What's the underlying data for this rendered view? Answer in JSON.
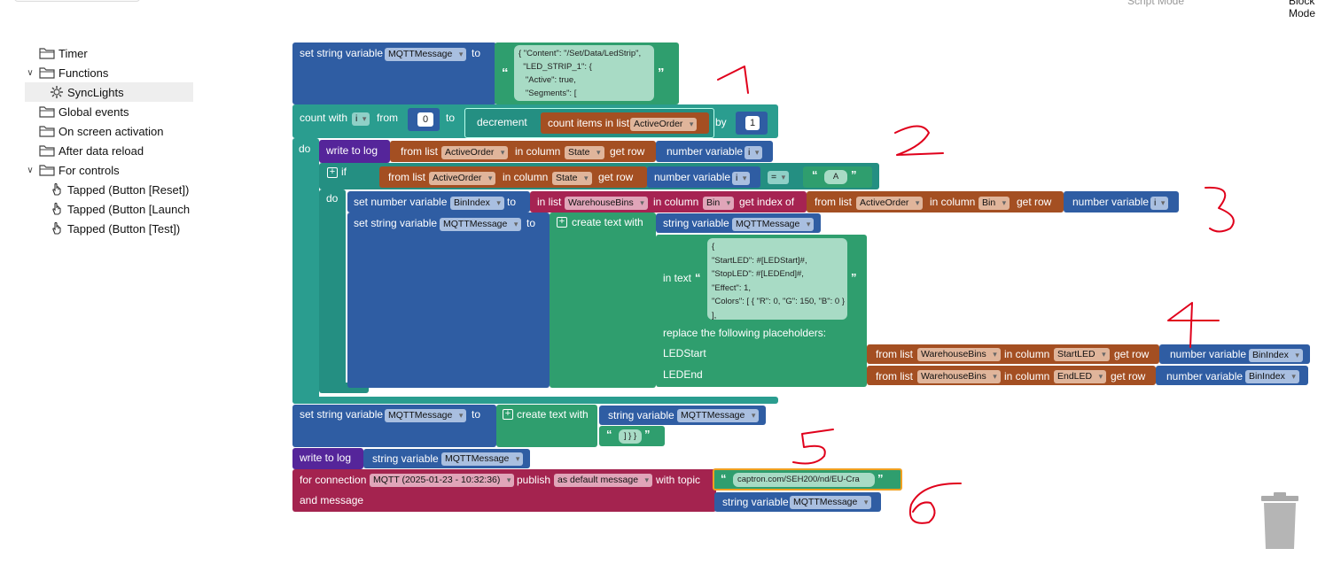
{
  "topbar": {
    "script_mode": "Script Mode",
    "block_mode": "Block Mode"
  },
  "tree": [
    {
      "label": "Timer",
      "type": "folder",
      "chevron": "",
      "selected": false
    },
    {
      "label": "Functions",
      "type": "folder",
      "chevron": "∨",
      "selected": false
    },
    {
      "label": "SyncLights",
      "type": "function",
      "chevron": "",
      "selected": true
    },
    {
      "label": "Global events",
      "type": "folder",
      "chevron": "",
      "selected": false
    },
    {
      "label": "On screen activation",
      "type": "folder",
      "chevron": "",
      "selected": false
    },
    {
      "label": "After data reload",
      "type": "folder",
      "chevron": "",
      "selected": false
    },
    {
      "label": "For controls",
      "type": "folder",
      "chevron": "∨",
      "selected": false
    },
    {
      "label": "Tapped (Button [Reset])",
      "type": "hand",
      "chevron": "",
      "selected": false
    },
    {
      "label": "Tapped (Button [Launch",
      "type": "hand",
      "chevron": "",
      "selected": false
    },
    {
      "label": "Tapped (Button [Test])",
      "type": "hand",
      "chevron": "",
      "selected": false
    }
  ],
  "blocks": {
    "b1_label": "set string variable",
    "b1_var": "MQTTMessage",
    "to": "to",
    "b1_text": "{ \"Content\": \"/Set/Data/LedStrip\",\n  \"LED_STRIP_1\": {\n   \"Active\": true,\n   \"Segments\": [",
    "count_with": "count with",
    "i": "i",
    "from": "from",
    "zero": "0",
    "decrement": "decrement",
    "count_items": "count items in list",
    "active_order": "ActiveOrder",
    "by": "by",
    "one": "1",
    "do": "do",
    "write_to_log": "write to log",
    "from_list": "from list",
    "in_column": "in column",
    "state": "State",
    "get_row": "get row",
    "number_variable": "number variable",
    "if": "if",
    "eq": "=",
    "a": "A",
    "set_number_variable": "set number variable",
    "bin_index": "BinIndex",
    "in_list": "in list",
    "warehouse_bins": "WarehouseBins",
    "bin": "Bin",
    "get_index_of": "get index of",
    "set_string_variable": "set string variable",
    "create_text_with": "create text with",
    "string_variable": "string variable",
    "in_text": "in text",
    "template_text": "{\n\"StartLED\": #[LEDStart]#,\n\"StopLED\": #[LEDEnd]#,\n\"Effect\": 1,\n\"Colors\": [ { \"R\": 0, \"G\": 150, \"B\": 0 }\n],",
    "replace_placeholders": "replace the following placeholders:",
    "led_start": "LEDStart",
    "led_end": "LEDEnd",
    "start_led": "StartLED",
    "end_led": "EndLED",
    "closing": "] } }",
    "for_connection": "for connection",
    "mqtt_conn": "MQTT (2025-01-23 - 10:32:36)",
    "publish": "publish",
    "as_default": "as default message",
    "with_topic": "with topic",
    "topic": "captron.com/SEH200/nd/EU-Cra",
    "and_message": "and message"
  },
  "annotations": [
    "1",
    "2",
    "3",
    "4",
    "5",
    "6"
  ],
  "colors": {
    "annotation": "#e0001b",
    "blue_block": "#2f5da3",
    "teal_block": "#2a9d8f",
    "green_block": "#2f9e6e",
    "orange_block": "#a44f22",
    "purple_block": "#55259a",
    "crimson_block": "#a4234f"
  }
}
